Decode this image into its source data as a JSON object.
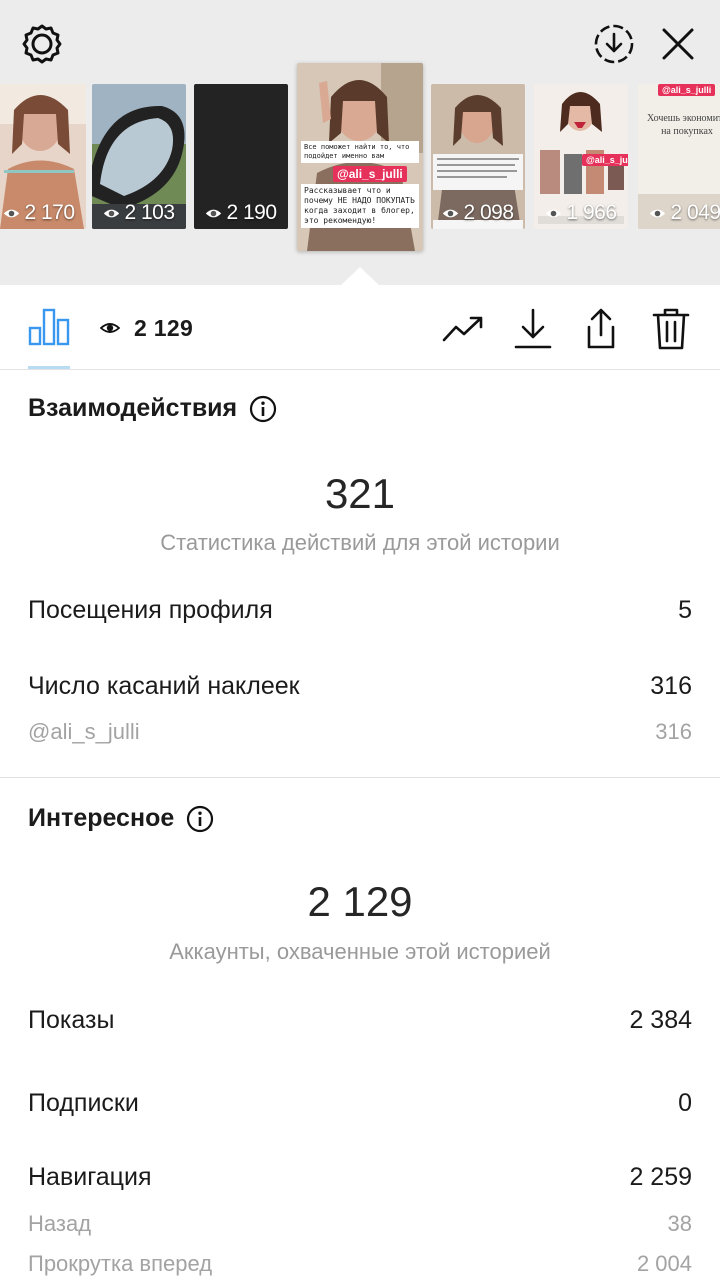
{
  "header": {
    "settings_icon": "settings-gear-icon",
    "download_icon": "download-circle-icon",
    "close_icon": "close-icon"
  },
  "stories": [
    {
      "views": "2 170",
      "colors": [
        "#d9b8a8",
        "#8a6253"
      ],
      "kind": "photo"
    },
    {
      "views": "2 103",
      "colors": [
        "#7f97a8",
        "#2a2d30"
      ],
      "kind": "mirror"
    },
    {
      "views": "2 190",
      "colors": [
        "#242424",
        "#1a1a1a"
      ],
      "kind": "dark"
    },
    {
      "views": "",
      "colors": [
        "#cdb9a2",
        "#8c6e5b"
      ],
      "kind": "selected"
    },
    {
      "views": "2 098",
      "colors": [
        "#c9b4a3",
        "#6f5d55"
      ],
      "kind": "text"
    },
    {
      "views": "1 966",
      "colors": [
        "#f2ede8",
        "#c96b6b"
      ],
      "kind": "collage"
    },
    {
      "views": "2 049",
      "colors": [
        "#f3efe8",
        "#d8d0c4"
      ],
      "kind": "note"
    }
  ],
  "selected_story": {
    "caption_1": "Все поможет найти то, что подойдет именно вам",
    "handle": "@ali_s_julli",
    "caption_2": "Рассказывает что и почему НЕ НАДО ПОКУПАТЬ когда заходит в блогер, это рекомендую!"
  },
  "story_handle_tag": "@ali_s_julli",
  "note_text": "Хочешь экономить на покупках",
  "toolbar": {
    "views": "2 129",
    "accent": "#3897f0"
  },
  "interactions": {
    "title": "Взаимодействия",
    "total": "321",
    "caption": "Статистика действий для этой истории",
    "rows": [
      {
        "label": "Посещения профиля",
        "value": "5"
      },
      {
        "label": "Число касаний наклеек",
        "value": "316"
      }
    ],
    "sub_row": {
      "label": "@ali_s_julli",
      "value": "316"
    }
  },
  "discovery": {
    "title": "Интересное",
    "total": "2 129",
    "caption": "Аккаунты, охваченные этой историей",
    "rows": [
      {
        "label": "Показы",
        "value": "2 384"
      },
      {
        "label": "Подписки",
        "value": "0"
      },
      {
        "label": "Навигация",
        "value": "2 259"
      }
    ],
    "sub_rows": [
      {
        "label": "Назад",
        "value": "38"
      },
      {
        "label": "Прокрутка вперед",
        "value": "2 004"
      }
    ]
  }
}
